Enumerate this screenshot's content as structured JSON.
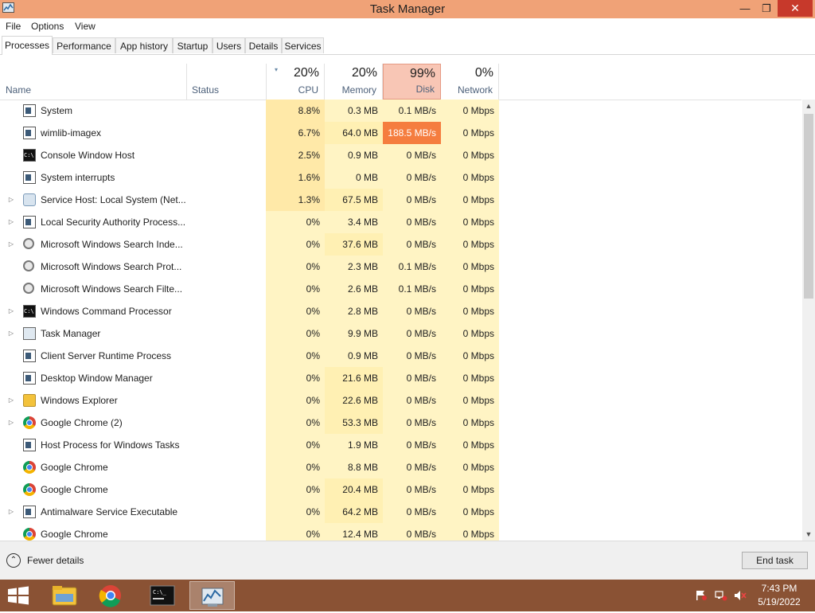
{
  "window": {
    "title": "Task Manager",
    "minimize": "—",
    "maximize": "❐",
    "close": "✕"
  },
  "menu": [
    "File",
    "Options",
    "View"
  ],
  "tabs": [
    "Processes",
    "Performance",
    "App history",
    "Startup",
    "Users",
    "Details",
    "Services"
  ],
  "active_tab": "Processes",
  "columns": {
    "name": "Name",
    "status": "Status",
    "cpu": {
      "pct": "20%",
      "label": "CPU"
    },
    "memory": {
      "pct": "20%",
      "label": "Memory"
    },
    "disk": {
      "pct": "99%",
      "label": "Disk"
    },
    "network": {
      "pct": "0%",
      "label": "Network"
    },
    "sort_indicator": "▾"
  },
  "processes": [
    {
      "expand": "",
      "icon": "window-icon",
      "name": "System",
      "cpu": "8.8%",
      "memory": "0.3 MB",
      "disk": "0.1 MB/s",
      "network": "0 Mbps"
    },
    {
      "expand": "",
      "icon": "window-icon",
      "name": "wimlib-imagex",
      "cpu": "6.7%",
      "memory": "64.0 MB",
      "disk": "188.5 MB/s",
      "network": "0 Mbps"
    },
    {
      "expand": "",
      "icon": "console-icon",
      "name": "Console Window Host",
      "cpu": "2.5%",
      "memory": "0.9 MB",
      "disk": "0 MB/s",
      "network": "0 Mbps"
    },
    {
      "expand": "",
      "icon": "window-icon",
      "name": "System interrupts",
      "cpu": "1.6%",
      "memory": "0 MB",
      "disk": "0 MB/s",
      "network": "0 Mbps"
    },
    {
      "expand": "▷",
      "icon": "gear-icon",
      "name": "Service Host: Local System (Net...",
      "cpu": "1.3%",
      "memory": "67.5 MB",
      "disk": "0 MB/s",
      "network": "0 Mbps"
    },
    {
      "expand": "▷",
      "icon": "window-icon",
      "name": "Local Security Authority Process...",
      "cpu": "0%",
      "memory": "3.4 MB",
      "disk": "0 MB/s",
      "network": "0 Mbps"
    },
    {
      "expand": "▷",
      "icon": "user-icon",
      "name": "Microsoft Windows Search Inde...",
      "cpu": "0%",
      "memory": "37.6 MB",
      "disk": "0 MB/s",
      "network": "0 Mbps"
    },
    {
      "expand": "",
      "icon": "user-icon",
      "name": "Microsoft Windows Search Prot...",
      "cpu": "0%",
      "memory": "2.3 MB",
      "disk": "0.1 MB/s",
      "network": "0 Mbps"
    },
    {
      "expand": "",
      "icon": "user-icon",
      "name": "Microsoft Windows Search Filte...",
      "cpu": "0%",
      "memory": "2.6 MB",
      "disk": "0.1 MB/s",
      "network": "0 Mbps"
    },
    {
      "expand": "▷",
      "icon": "console-icon",
      "name": "Windows Command Processor",
      "cpu": "0%",
      "memory": "2.8 MB",
      "disk": "0 MB/s",
      "network": "0 Mbps"
    },
    {
      "expand": "▷",
      "icon": "task-manager-icon",
      "name": "Task Manager",
      "cpu": "0%",
      "memory": "9.9 MB",
      "disk": "0 MB/s",
      "network": "0 Mbps"
    },
    {
      "expand": "",
      "icon": "window-icon",
      "name": "Client Server Runtime Process",
      "cpu": "0%",
      "memory": "0.9 MB",
      "disk": "0 MB/s",
      "network": "0 Mbps"
    },
    {
      "expand": "",
      "icon": "window-icon",
      "name": "Desktop Window Manager",
      "cpu": "0%",
      "memory": "21.6 MB",
      "disk": "0 MB/s",
      "network": "0 Mbps"
    },
    {
      "expand": "▷",
      "icon": "folder-icon",
      "name": "Windows Explorer",
      "cpu": "0%",
      "memory": "22.6 MB",
      "disk": "0 MB/s",
      "network": "0 Mbps"
    },
    {
      "expand": "▷",
      "icon": "chrome-icon",
      "name": "Google Chrome (2)",
      "cpu": "0%",
      "memory": "53.3 MB",
      "disk": "0 MB/s",
      "network": "0 Mbps"
    },
    {
      "expand": "",
      "icon": "window-icon",
      "name": "Host Process for Windows Tasks",
      "cpu": "0%",
      "memory": "1.9 MB",
      "disk": "0 MB/s",
      "network": "0 Mbps"
    },
    {
      "expand": "",
      "icon": "chrome-icon",
      "name": "Google Chrome",
      "cpu": "0%",
      "memory": "8.8 MB",
      "disk": "0 MB/s",
      "network": "0 Mbps"
    },
    {
      "expand": "",
      "icon": "chrome-icon",
      "name": "Google Chrome",
      "cpu": "0%",
      "memory": "20.4 MB",
      "disk": "0 MB/s",
      "network": "0 Mbps"
    },
    {
      "expand": "▷",
      "icon": "window-icon",
      "name": "Antimalware Service Executable",
      "cpu": "0%",
      "memory": "64.2 MB",
      "disk": "0 MB/s",
      "network": "0 Mbps"
    },
    {
      "expand": "",
      "icon": "chrome-icon",
      "name": "Google Chrome",
      "cpu": "0%",
      "memory": "12.4 MB",
      "disk": "0 MB/s",
      "network": "0 Mbps"
    }
  ],
  "footer": {
    "fewer_details": "Fewer details",
    "fewer_icon": "⌃",
    "end_task": "End task"
  },
  "taskbar": {
    "apps": [
      "file-explorer-icon",
      "chrome-icon",
      "command-prompt-icon",
      "task-manager-icon"
    ],
    "time": "7:43 PM",
    "date": "5/19/2022"
  },
  "colors": {
    "titlebar": "#f0a277",
    "close": "#c7392b",
    "disk_hot": "#f57d3f",
    "disk_header": "#f8c6b5",
    "heat_low": "#fff4c4",
    "taskbar": "#8a5234"
  }
}
